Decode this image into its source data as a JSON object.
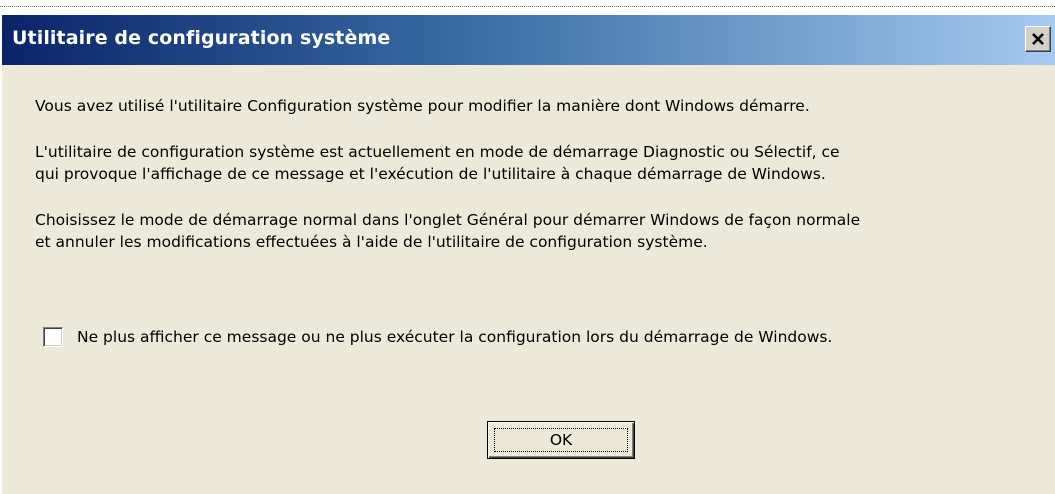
{
  "window": {
    "title": "Utilitaire de configuration système",
    "close_icon": "close-icon"
  },
  "message": {
    "line1": "Vous avez utilisé l'utilitaire Configuration système pour modifier la manière dont Windows démarre.",
    "line2a": "L'utilitaire de configuration système est actuellement en mode de démarrage Diagnostic ou Sélectif, ce",
    "line2b": "qui provoque l'affichage de ce message et l'exécution de l'utilitaire à chaque démarrage de Windows.",
    "line3a": "Choisissez le mode de démarrage normal dans l'onglet Général pour démarrer Windows de façon normale",
    "line3b": "et annuler les modifications effectuées à l'aide de l'utilitaire de configuration système."
  },
  "checkbox": {
    "label": "Ne plus afficher ce message ou ne plus exécuter la configuration lors du démarrage de Windows.",
    "checked": false
  },
  "buttons": {
    "ok_label": "OK"
  },
  "colors": {
    "title_start": "#0a246a",
    "title_end": "#a6caf0",
    "client_bg": "#ece9d8"
  }
}
